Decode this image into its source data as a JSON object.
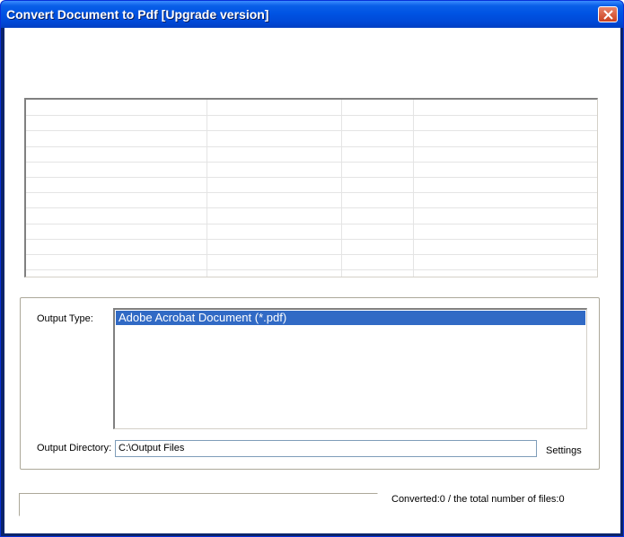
{
  "window": {
    "title": "Convert Document to Pdf [Upgrade version]"
  },
  "output": {
    "type_label": "Output Type:",
    "type_options": [
      "Adobe Acrobat Document (*.pdf)"
    ],
    "directory_label": "Output Directory:",
    "directory_value": "C:\\Output Files",
    "settings_label": "Settings"
  },
  "status": {
    "converted_text": "Converted:0  /  the total number of files:0"
  },
  "colors": {
    "titlebar": "#0054e3",
    "selection": "#316ac5",
    "close_button": "#c9411f"
  },
  "icons": {
    "close": "close-icon"
  }
}
